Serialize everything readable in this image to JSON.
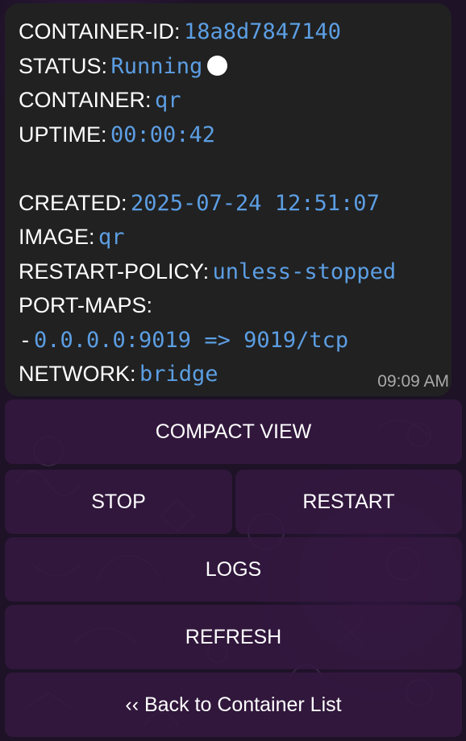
{
  "message": {
    "fields": [
      {
        "key": "CONTAINER-ID:",
        "value": "18a8d7847140"
      },
      {
        "key": "STATUS:",
        "value": "Running"
      },
      {
        "key": "CONTAINER:",
        "value": "qr"
      },
      {
        "key": "UPTIME:",
        "value": "00:00:42"
      },
      {
        "key": "CREATED:",
        "value": "2025-07-24 12:51:07"
      },
      {
        "key": "IMAGE:",
        "value": "qr"
      },
      {
        "key": "RESTART-POLICY:",
        "value": "unless-stopped"
      },
      {
        "key": "PORT-MAPS:",
        "value": ""
      },
      {
        "key": "-",
        "value": "0.0.0.0:9019 => 9019/tcp"
      },
      {
        "key": "NETWORK:",
        "value": "bridge"
      }
    ],
    "status_indicator": "white-circle",
    "time": "09:09 AM"
  },
  "buttons": {
    "compact_view": "COMPACT VIEW",
    "stop": "STOP",
    "restart": "RESTART",
    "logs": "LOGS",
    "refresh": "REFRESH",
    "back": "‹‹ Back to Container List"
  },
  "colors": {
    "bubble_bg": "#212121",
    "value_text": "#5c9ee3",
    "button_bg": "#341840",
    "timestamp": "#a9a9a9"
  }
}
